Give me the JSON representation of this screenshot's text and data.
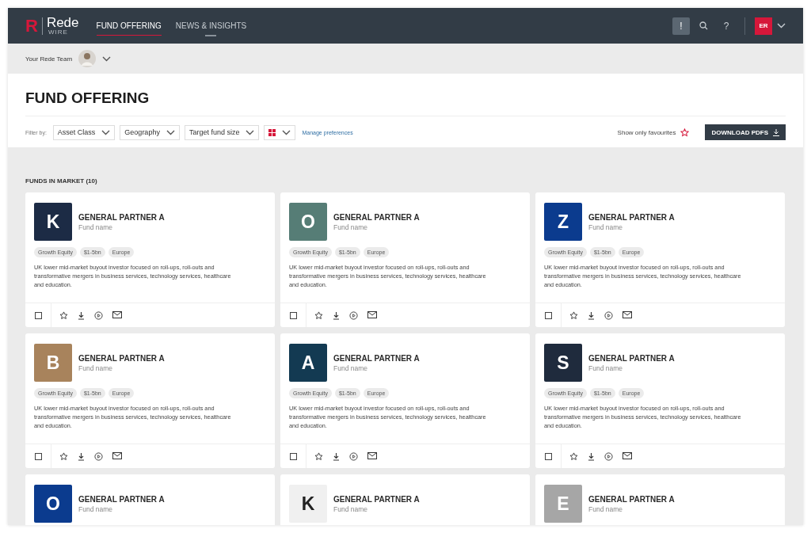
{
  "header": {
    "logo_mark": "R",
    "logo_name": "Rede",
    "logo_sub": "WIRE",
    "nav": [
      {
        "label": "FUND OFFERING",
        "selected": true
      },
      {
        "label": "NEWS & INSIGHTS",
        "selected": false
      }
    ],
    "alert_label": "!",
    "help_label": "?",
    "user_initials": "ER"
  },
  "team_bar": {
    "label": "Your Rede Team"
  },
  "page": {
    "title": "FUND OFFERING",
    "filter_label": "Filter by:",
    "filters": [
      "Asset Class",
      "Geography",
      "Target fund size"
    ],
    "manage_link": "Manage preferences",
    "favourites_label": "Show only favourites",
    "download_button": "DOWNLOAD PDFS"
  },
  "section": {
    "title": "FUNDS IN MARKET (10)"
  },
  "cards": [
    {
      "letter": "K",
      "color": "#1c2b45",
      "partner": "GENERAL PARTNER A",
      "fund": "Fund name",
      "tags": [
        "Growth Equity",
        "$1-5bn",
        "Europe"
      ],
      "description": "UK lower mid-market buyout investor focused on roll-ups, roll-outs and transformative mergers in business services, technology services, healthcare and education.",
      "checked": false
    },
    {
      "letter": "O",
      "color": "#567d76",
      "partner": "GENERAL PARTNER A",
      "fund": "Fund name",
      "tags": [
        "Growth Equity",
        "$1-5bn",
        "Europe"
      ],
      "description": "UK lower mid-market buyout investor focused on roll-ups, roll-outs and transformative mergers in business services, technology services, healthcare and education.",
      "checked": false
    },
    {
      "letter": "Z",
      "color": "#0b3b8e",
      "partner": "GENERAL PARTNER A",
      "fund": "Fund name",
      "tags": [
        "Growth Equity",
        "$1-5bn",
        "Europe"
      ],
      "description": "UK lower mid-market buyout investor focused on roll-ups, roll-outs and transformative mergers in business services, technology services, healthcare and education.",
      "checked": false
    },
    {
      "letter": "B",
      "color": "#a8835c",
      "partner": "GENERAL PARTNER A",
      "fund": "Fund name",
      "tags": [
        "Growth Equity",
        "$1-5bn",
        "Europe"
      ],
      "description": "UK lower mid-market buyout investor focused on roll-ups, roll-outs and transformative mergers in business services, technology services, healthcare and education.",
      "checked": false
    },
    {
      "letter": "A",
      "color": "#133a52",
      "partner": "GENERAL PARTNER A",
      "fund": "Fund name",
      "tags": [
        "Growth Equity",
        "$1-5bn",
        "Europe"
      ],
      "description": "UK lower mid-market buyout investor focused on roll-ups, roll-outs and transformative mergers in business services, technology services, healthcare and education.",
      "checked": false
    },
    {
      "letter": "S",
      "color": "#1f2b3d",
      "partner": "GENERAL PARTNER A",
      "fund": "Fund name",
      "tags": [
        "Growth Equity",
        "$1-5bn",
        "Europe"
      ],
      "description": "UK lower mid-market buyout investor focused on roll-ups, roll-outs and transformative mergers in business services, technology services, healthcare and education.",
      "checked": false
    },
    {
      "letter": "O",
      "color": "#0b3b8e",
      "partner": "GENERAL PARTNER A",
      "fund": "Fund name"
    },
    {
      "letter": "K",
      "color": "#f0f0f0",
      "partner": "GENERAL PARTNER A",
      "fund": "Fund name"
    },
    {
      "letter": "E",
      "color": "#a6a6a6",
      "partner": "GENERAL PARTNER A",
      "fund": "Fund name"
    }
  ]
}
